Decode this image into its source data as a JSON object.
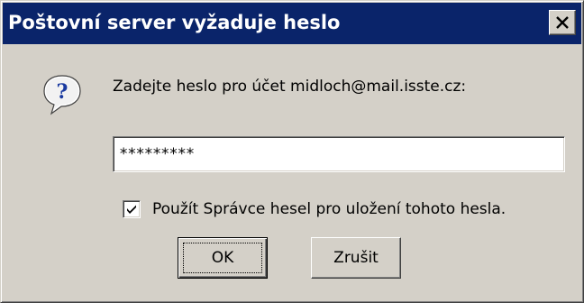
{
  "window": {
    "title": "Poštovní server vyžaduje heslo",
    "close_icon": "close-icon"
  },
  "dialog": {
    "icon": "question-icon",
    "prompt": "Zadejte heslo pro účet midloch@mail.isste.cz:",
    "password_value": "*********",
    "remember": {
      "checked": true,
      "label": "Použít Správce hesel pro uložení tohoto hesla."
    }
  },
  "buttons": {
    "ok_label": "OK",
    "cancel_label": "Zrušit"
  },
  "colors": {
    "titlebar": "#0a246a",
    "face": "#d4d0c8"
  }
}
